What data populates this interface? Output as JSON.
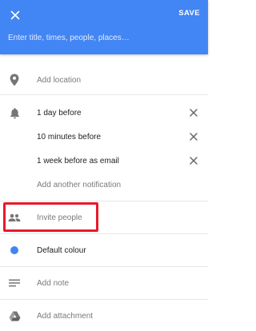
{
  "header": {
    "save_label": "SAVE",
    "title_placeholder": "Enter title, times, people, places…"
  },
  "location": {
    "label": "Add location",
    "icon": "location-pin-icon"
  },
  "notifications": {
    "icon": "bell-icon",
    "items": [
      {
        "label": "1 day before"
      },
      {
        "label": "10 minutes before"
      },
      {
        "label": "1 week before as email"
      }
    ],
    "add_label": "Add another notification"
  },
  "invite": {
    "label": "Invite people",
    "icon": "people-icon"
  },
  "colour": {
    "label": "Default colour",
    "color": "#4285f4"
  },
  "note": {
    "label": "Add note",
    "icon": "notes-icon"
  },
  "attachment": {
    "label": "Add attachment",
    "icon": "drive-icon"
  },
  "colors": {
    "accent": "#4285f4",
    "highlight": "#e8192c"
  }
}
